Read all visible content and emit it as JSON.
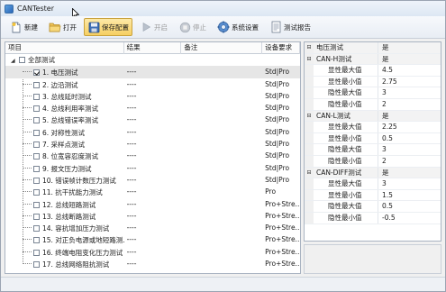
{
  "window": {
    "title": "CANTester"
  },
  "toolbar": {
    "new_label": "新建",
    "open_label": "打开",
    "save_label": "保存配置",
    "start_label": "开启",
    "stop_label": "停止",
    "settings_label": "系统设置",
    "report_label": "测试报告"
  },
  "grid": {
    "headers": {
      "name": "项目",
      "result": "结果",
      "note": "备注",
      "requirement": "设备要求"
    },
    "root_label": "全部测试",
    "rows": [
      {
        "name": "1. 电压测试",
        "result": "----",
        "note": "",
        "req": "Std|Pro",
        "checked": true
      },
      {
        "name": "2. 边沿测试",
        "result": "----",
        "note": "",
        "req": "Std|Pro",
        "checked": false
      },
      {
        "name": "3. 总线延时测试",
        "result": "----",
        "note": "",
        "req": "Std|Pro",
        "checked": false
      },
      {
        "name": "4. 总线利用率测试",
        "result": "----",
        "note": "",
        "req": "Std|Pro",
        "checked": false
      },
      {
        "name": "5. 总线错误率测试",
        "result": "----",
        "note": "",
        "req": "Std|Pro",
        "checked": false
      },
      {
        "name": "6. 对称性测试",
        "result": "----",
        "note": "",
        "req": "Std|Pro",
        "checked": false
      },
      {
        "name": "7. 采样点测试",
        "result": "----",
        "note": "",
        "req": "Std|Pro",
        "checked": false
      },
      {
        "name": "8. 位宽容忍度测试",
        "result": "----",
        "note": "",
        "req": "Std|Pro",
        "checked": false
      },
      {
        "name": "9. 报文压力测试",
        "result": "----",
        "note": "",
        "req": "Std|Pro",
        "checked": false
      },
      {
        "name": "10. 错误帧计数压力测试",
        "result": "----",
        "note": "",
        "req": "Std|Pro",
        "checked": false
      },
      {
        "name": "11. 抗干扰能力测试",
        "result": "----",
        "note": "",
        "req": "Pro",
        "checked": false
      },
      {
        "name": "12. 总线短路测试",
        "result": "----",
        "note": "",
        "req": "Pro+Stre...",
        "checked": false
      },
      {
        "name": "13. 总线断路测试",
        "result": "----",
        "note": "",
        "req": "Pro+Stre...",
        "checked": false
      },
      {
        "name": "14. 容抗增加压力测试",
        "result": "----",
        "note": "",
        "req": "Pro+Stre...",
        "checked": false
      },
      {
        "name": "15. 对正负电源或地短路测...",
        "result": "----",
        "note": "",
        "req": "Pro+Stre...",
        "checked": false
      },
      {
        "name": "16. 终端电阻变化压力测试",
        "result": "----",
        "note": "",
        "req": "Pro+Stre...",
        "checked": false
      },
      {
        "name": "17. 总线网络阻抗测试",
        "result": "----",
        "note": "",
        "req": "Pro+Stre...",
        "checked": false
      }
    ]
  },
  "properties": {
    "title": "电压测试",
    "title_value": "是",
    "groups": [
      {
        "name": "CAN-H测试",
        "value": "是",
        "items": [
          {
            "name": "显性最大值",
            "value": "4.5"
          },
          {
            "name": "显性最小值",
            "value": "2.75"
          },
          {
            "name": "隐性最大值",
            "value": "3"
          },
          {
            "name": "隐性最小值",
            "value": "2"
          }
        ]
      },
      {
        "name": "CAN-L测试",
        "value": "是",
        "items": [
          {
            "name": "显性最大值",
            "value": "2.25"
          },
          {
            "name": "显性最小值",
            "value": "0.5"
          },
          {
            "name": "隐性最大值",
            "value": "3"
          },
          {
            "name": "隐性最小值",
            "value": "2"
          }
        ]
      },
      {
        "name": "CAN-DIFF测试",
        "value": "是",
        "items": [
          {
            "name": "显性最大值",
            "value": "3"
          },
          {
            "name": "显性最小值",
            "value": "1.5"
          },
          {
            "name": "隐性最大值",
            "value": "0.5"
          },
          {
            "name": "隐性最小值",
            "value": "-0.5"
          }
        ]
      }
    ]
  },
  "icons": {
    "app": "app-icon",
    "new": "new-file-icon",
    "open": "folder-icon",
    "save": "save-icon",
    "start": "play-icon",
    "stop": "stop-icon",
    "settings": "gear-icon",
    "report": "report-icon"
  },
  "colors": {
    "toolbar_active": "#f6cf62",
    "window_bg": "#f0f0f0",
    "border": "#a9b3c1"
  }
}
